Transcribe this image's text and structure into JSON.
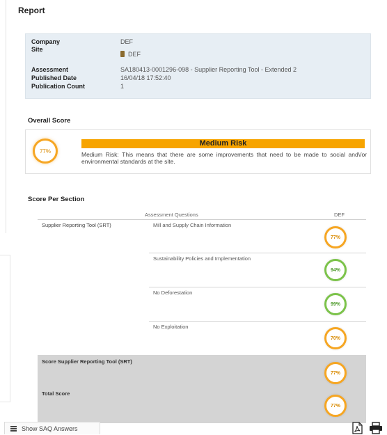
{
  "report": {
    "title": "Report"
  },
  "info": {
    "company_label": "Company",
    "company_value": "DEF",
    "site_label": "Site",
    "site_value": "DEF",
    "assessment_label": "Assessment",
    "assessment_value": "SA180413-0001296-098 - Supplier Reporting Tool - Extended 2",
    "published_label": "Published Date",
    "published_value": "16/04/18 17:52:40",
    "count_label": "Publication Count",
    "count_value": "1"
  },
  "overall": {
    "heading": "Overall Score",
    "score": "77%",
    "risk_label": "Medium Risk",
    "description": "Medium Risk: This means that there are some improvements that need to be made to social and\\/or environmental standards at the site."
  },
  "per_section": {
    "heading": "Score Per Section",
    "col_questions": "Assessment Questions",
    "col_site": "DEF",
    "section_name": "Supplier Reporting Tool (SRT)",
    "questions": [
      {
        "label": "Mill and Supply Chain Information",
        "score": "77%"
      },
      {
        "label": "Sustainability Policies and Implementation",
        "score": "94%"
      },
      {
        "label": "No Deforestation",
        "score": "99%"
      },
      {
        "label": "No Exploitation",
        "score": "70%"
      }
    ],
    "section_total_label": "Score Supplier Reporting Tool (SRT)",
    "section_total_score": "77%",
    "total_label": "Total Score",
    "total_score": "77%"
  },
  "footer": {
    "saq_button": "Show SAQ Answers"
  },
  "icons": {
    "pdf": "pdf-icon",
    "print": "print-icon",
    "list": "list-icon",
    "document": "document-icon"
  },
  "colors": {
    "medium_risk": "#f7a400",
    "score_orange": "#f6a623",
    "score_green": "#7cc34a"
  }
}
